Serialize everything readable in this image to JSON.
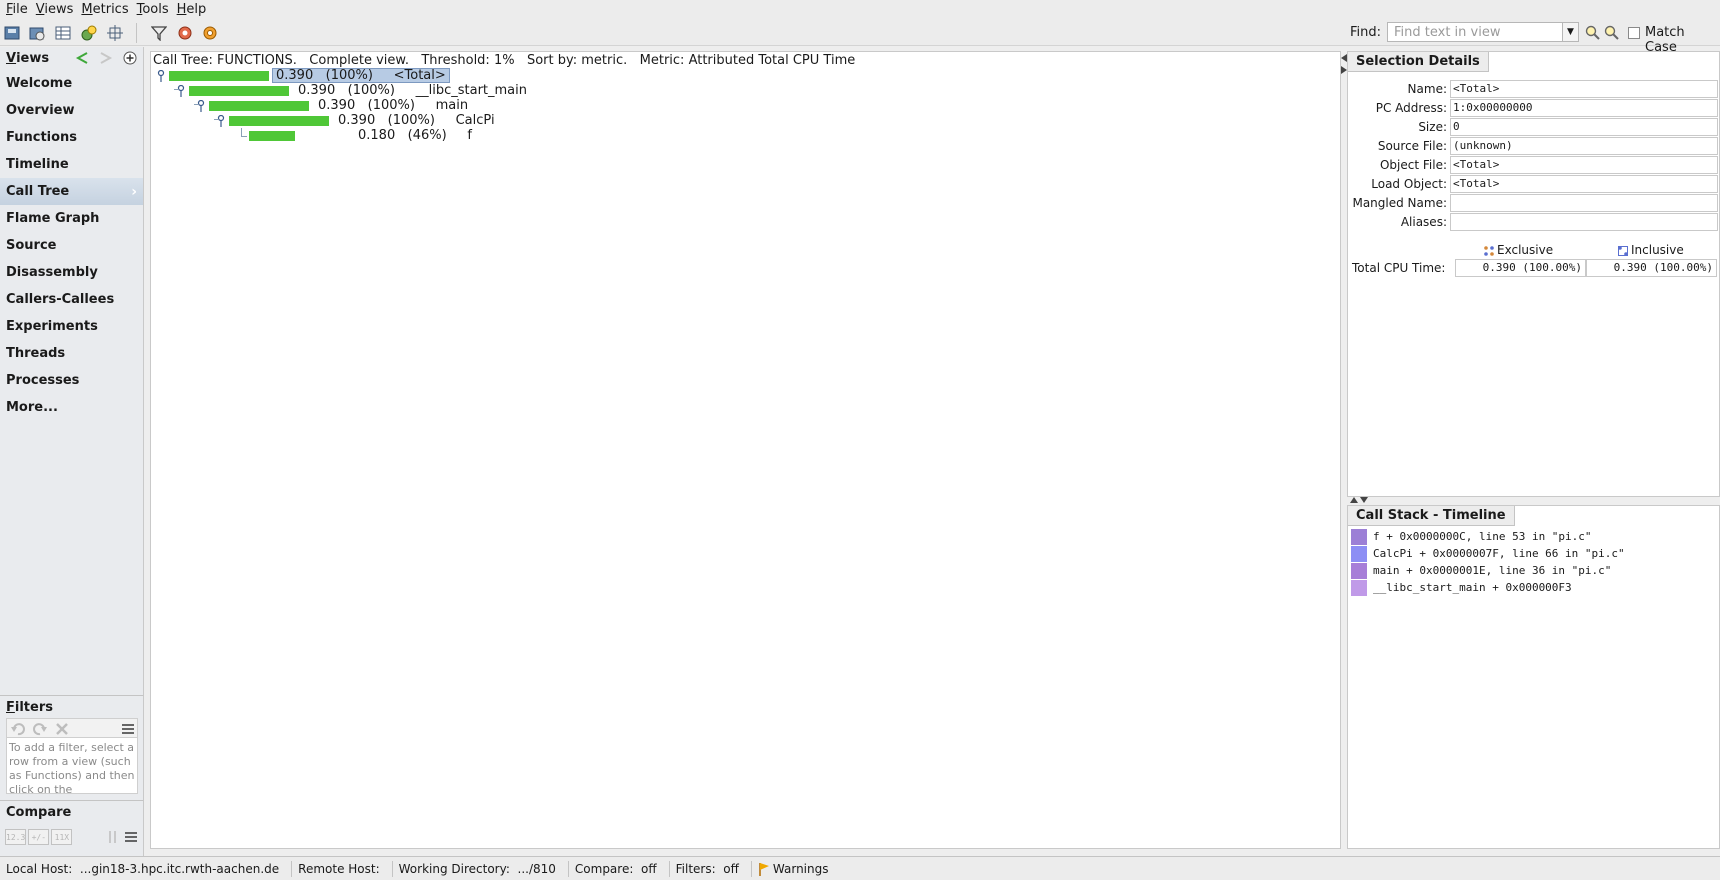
{
  "menubar": {
    "items": [
      {
        "mnemonic": "F",
        "rest": "ile"
      },
      {
        "mnemonic": "V",
        "rest": "iews"
      },
      {
        "mnemonic": "M",
        "rest": "etrics"
      },
      {
        "mnemonic": "T",
        "rest": "ools"
      },
      {
        "mnemonic": "H",
        "rest": "elp"
      }
    ]
  },
  "toolbar": {
    "find_label": "Find:",
    "find_placeholder": "Find text in view",
    "match_case_label": "Match Case"
  },
  "views": {
    "title_mnemonic": "V",
    "title_rest": "iews",
    "items": [
      "Welcome",
      "Overview",
      "Functions",
      "Timeline",
      "Call Tree",
      "Flame Graph",
      "Source",
      "Disassembly",
      "Callers-Callees",
      "Experiments",
      "Threads",
      "Processes",
      "More..."
    ],
    "active": "Call Tree"
  },
  "filters": {
    "title_mnemonic": "F",
    "title_rest": "ilters",
    "help_text": "To add a filter, select a row from a view (such as Functions) and then click on the"
  },
  "compare": {
    "title": "Compare",
    "buttons": [
      "12.3",
      "+/-",
      "11X"
    ]
  },
  "calltree": {
    "header": "Call Tree: FUNCTIONS.   Complete view.   Threshold: 1%   Sort by: metric.   Metric: Attributed Total CPU Time",
    "rows": [
      {
        "value": "0.390",
        "percent": "(100%)",
        "name": "<Total>",
        "selected": true
      },
      {
        "value": "0.390",
        "percent": "(100%)",
        "name": "__libc_start_main",
        "selected": false
      },
      {
        "value": "0.390",
        "percent": "(100%)",
        "name": "main",
        "selected": false
      },
      {
        "value": "0.390",
        "percent": "(100%)",
        "name": "CalcPi",
        "selected": false
      },
      {
        "value": "0.180",
        "percent": "(46%)",
        "name": "f",
        "selected": false
      }
    ]
  },
  "selection_details": {
    "title": "Selection Details",
    "fields": [
      {
        "label": "Name:",
        "value": "<Total>"
      },
      {
        "label": "PC Address:",
        "value": "1:0x00000000"
      },
      {
        "label": "Size:",
        "value": "0"
      },
      {
        "label": "Source File:",
        "value": "(unknown)"
      },
      {
        "label": "Object File:",
        "value": "<Total>"
      },
      {
        "label": "Load Object:",
        "value": "<Total>"
      },
      {
        "label": "Mangled Name:",
        "value": ""
      },
      {
        "label": "Aliases:",
        "value": ""
      }
    ],
    "exclusive_label": "Exclusive",
    "inclusive_label": "Inclusive",
    "metric_label": "Total CPU Time:",
    "exclusive_value": "0.390 (100.00%)",
    "inclusive_value": "0.390 (100.00%)"
  },
  "call_stack": {
    "title": "Call Stack - Timeline",
    "frames": [
      {
        "text": "f + 0x0000000C, line 53 in \"pi.c\"",
        "color": "#9c7fd6"
      },
      {
        "text": "CalcPi + 0x0000007F, line 66 in \"pi.c\"",
        "color": "#8d8ef4"
      },
      {
        "text": "main + 0x0000001E, line 36 in \"pi.c\"",
        "color": "#a77ed8"
      },
      {
        "text": "__libc_start_main + 0x000000F3",
        "color": "#c09ae8"
      }
    ]
  },
  "statusbar": {
    "local_host": "Local Host:  ...gin18-3.hpc.itc.rwth-aachen.de",
    "remote_host": "Remote Host:",
    "working_dir": "Working Directory:  .../810",
    "compare": "Compare:  off",
    "filters": "Filters:  off",
    "warnings": "Warnings"
  },
  "colors": {
    "bar": "#4fc737",
    "selection": "#b7cbe4",
    "active_view": "#c9d5e2"
  }
}
